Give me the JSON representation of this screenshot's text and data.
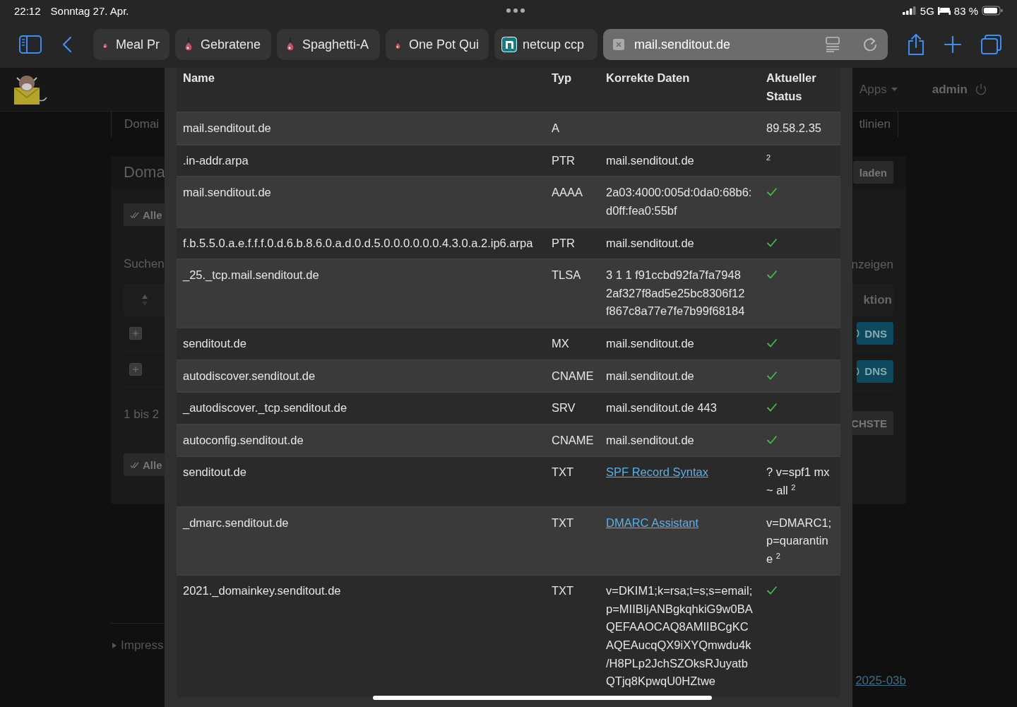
{
  "status_bar": {
    "time": "22:12",
    "date": "Sonntag 27. Apr.",
    "network": "5G",
    "battery": "83 %"
  },
  "browser_tabs": [
    {
      "label": "Meal Pr",
      "kind": "recipe",
      "selected": false
    },
    {
      "label": "Gebratene",
      "kind": "recipe",
      "selected": false
    },
    {
      "label": "Spaghetti-A",
      "kind": "recipe",
      "selected": false
    },
    {
      "label": "One Pot Qui",
      "kind": "recipe",
      "selected": false
    },
    {
      "label": "netcup ccp",
      "kind": "netcup",
      "selected": false
    },
    {
      "label": "mail.senditout.de",
      "kind": "address",
      "selected": true
    }
  ],
  "background_page": {
    "apps_menu": "Apps",
    "user": "admin",
    "tab_left": "Domai",
    "tab_right": "tlinien",
    "panel_title": "Doma",
    "reload_button": "laden",
    "select_buttons": [
      "Alle",
      "Alle"
    ],
    "search_label": "Suchen",
    "show_label": "nzeigen",
    "action_header": "ktion",
    "dns_buttons": [
      "DNS",
      "DNS"
    ],
    "info_text": "1 bis 2",
    "next_button": "CHSTE",
    "footer_link": "Impress",
    "version_link": "2025-03b"
  },
  "dns_table": {
    "columns": [
      "Name",
      "Typ",
      "Korrekte Daten",
      "Aktueller Status"
    ],
    "rows": [
      {
        "name": "mail.senditout.de",
        "type": "A",
        "status": {
          "kind": "text",
          "text": "89.58.2.35"
        }
      },
      {
        "name": ".in-addr.arpa",
        "type": "PTR",
        "data": {
          "kind": "text",
          "text": "mail.senditout.de"
        },
        "status": {
          "kind": "text",
          "text": "$^{2}$"
        }
      },
      {
        "name": "mail.senditout.de",
        "type": "AAAA",
        "data": {
          "kind": "text",
          "text": "2a03:4000:005d:0da0:68b6:d0ff:fea0:55bf"
        },
        "status": {
          "kind": "check"
        }
      },
      {
        "name": "f.b.5.5.0.a.e.f.f.f.0.d.6.b.8.6.0.a.d.0.d.5.0.0.0.0.0.0.4.3.0.a.2.ip6.arpa",
        "type": "PTR",
        "data": {
          "kind": "text",
          "text": "mail.senditout.de"
        },
        "status": {
          "kind": "check"
        }
      },
      {
        "name": "_25._tcp.mail.senditout.de",
        "type": "TLSA",
        "data": {
          "kind": "text",
          "text": "3 1 1 f91ccbd92fa7fa7948 2af327f8ad5e25bc8306f12 f867c8a77e7fe7b99f68184"
        },
        "status": {
          "kind": "check"
        }
      },
      {
        "name": "senditout.de",
        "type": "MX",
        "data": {
          "kind": "text",
          "text": "mail.senditout.de"
        },
        "status": {
          "kind": "check"
        }
      },
      {
        "name": "autodiscover.senditout.de",
        "type": "CNAME",
        "data": {
          "kind": "text",
          "text": "mail.senditout.de"
        },
        "status": {
          "kind": "check"
        }
      },
      {
        "name": "_autodiscover._tcp.senditout.de",
        "type": "SRV",
        "data": {
          "kind": "text",
          "text": "mail.senditout.de 443"
        },
        "status": {
          "kind": "check"
        }
      },
      {
        "name": "autoconfig.senditout.de",
        "type": "CNAME",
        "data": {
          "kind": "text",
          "text": "mail.senditout.de"
        },
        "status": {
          "kind": "check"
        }
      },
      {
        "name": "senditout.de",
        "type": "TXT",
        "data": {
          "kind": "link",
          "text": "SPF Record Syntax"
        },
        "status": {
          "kind": "text",
          "text": "? v=spf1 mx ~ all $^{2}$"
        }
      },
      {
        "name": "_dmarc.senditout.de",
        "type": "TXT",
        "data": {
          "kind": "link",
          "text": "DMARC Assistant"
        },
        "status": {
          "kind": "text",
          "text": "v=DMARC1; p=quarantine $^{2}$"
        }
      },
      {
        "name": "2021._domainkey.senditout.de",
        "type": "TXT",
        "data": {
          "kind": "text",
          "text": "v=DKIM1;k=rsa;t=s;s=email;p=MIIBIjANBgkqhkiG9w0BAQEFAAOCAQ8AMIIBCgKCAQEAucqQX9iXYQmwdu4k/H8PLp2JchSZOksRJuyatbQTjq8KpwqU0HZtwe"
        },
        "status": {
          "kind": "check"
        }
      }
    ]
  }
}
